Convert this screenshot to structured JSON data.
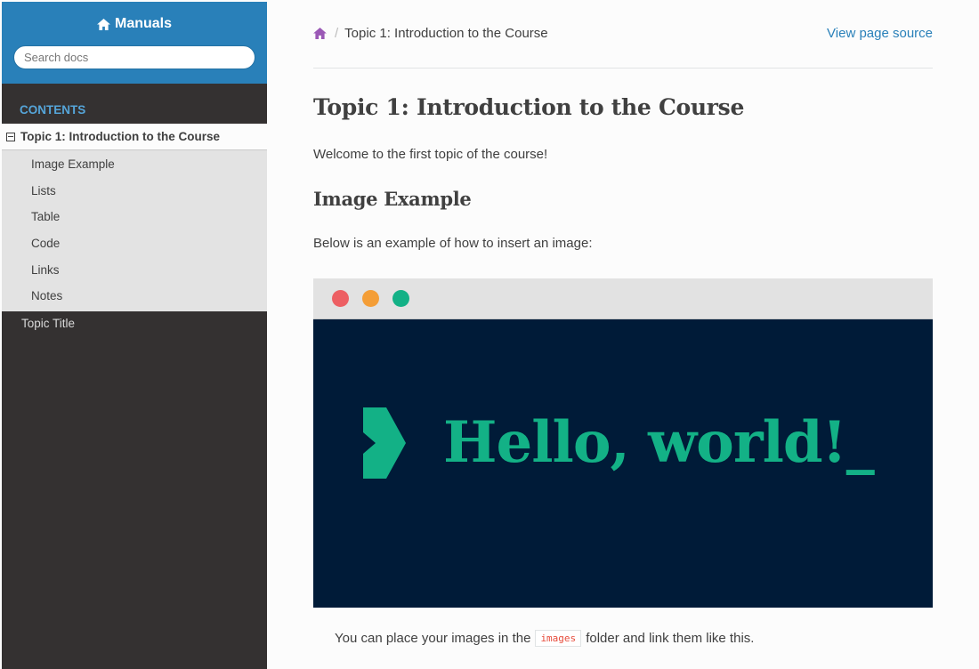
{
  "sidebar": {
    "brand": "Manuals",
    "search_placeholder": "Search docs",
    "caption": "CONTENTS",
    "current": "Topic 1: Introduction to the Course",
    "sub_items": [
      "Image Example",
      "Lists",
      "Table",
      "Code",
      "Links",
      "Notes"
    ],
    "other_items": [
      "Topic Title"
    ]
  },
  "breadcrumb": {
    "current": "Topic 1: Introduction to the Course",
    "view_source": "View page source"
  },
  "content": {
    "title": "Topic 1: Introduction to the Course",
    "welcome": "Welcome to the first topic of the course!",
    "section_title": "Image Example",
    "below_text": "Below is an example of how to insert an image:",
    "image_text": "Hello, world!_",
    "caption_before": "You can place your images in the",
    "caption_code": "images",
    "caption_after": "folder and link them like this."
  },
  "colors": {
    "accent": "#2980b9",
    "sidebar_bg": "#343131",
    "dot_red": "#ed5f63",
    "dot_orange": "#f49e37",
    "dot_green": "#13b186",
    "image_bg": "#001b38"
  },
  "icons": {
    "brand": "home-icon",
    "breadcrumb_home": "home-icon",
    "toggle": "collapse-icon"
  }
}
